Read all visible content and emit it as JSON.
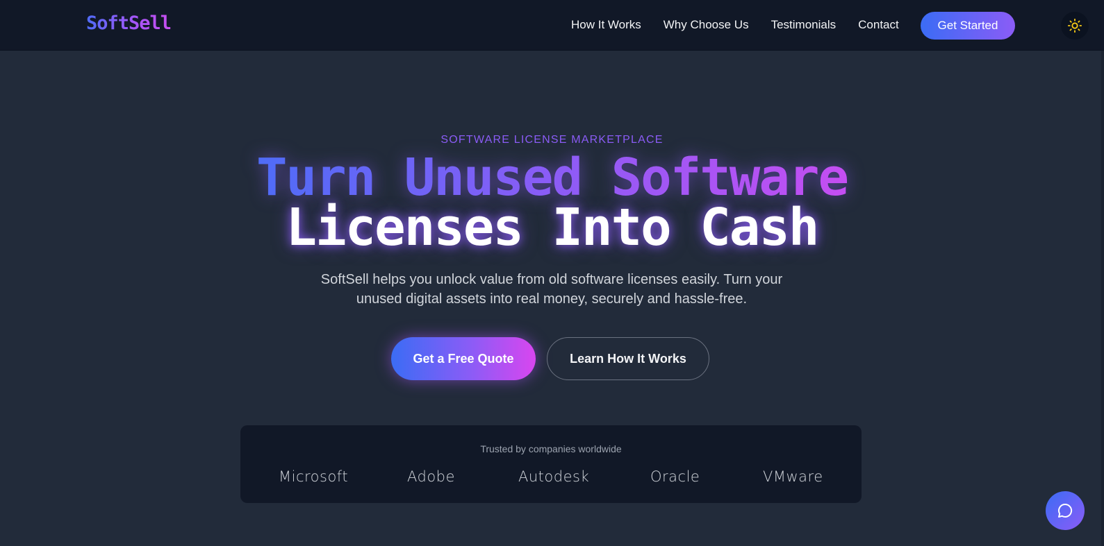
{
  "header": {
    "logo": "SoftSell",
    "nav": [
      "How It Works",
      "Why Choose Us",
      "Testimonials",
      "Contact"
    ],
    "cta": "Get Started",
    "theme_icon": "sun-icon"
  },
  "hero": {
    "eyebrow": "SOFTWARE LICENSE MARKETPLACE",
    "headline_line1": "Turn Unused Software",
    "headline_line2": "Licenses Into Cash",
    "subtitle": "SoftSell helps you unlock value from old software licenses easily. Turn your unused digital assets into real money, securely and hassle-free.",
    "primary_button": "Get a Free Quote",
    "secondary_button": "Learn How It Works"
  },
  "trusted": {
    "label": "Trusted by companies worldwide",
    "companies": [
      "Microsoft",
      "Adobe",
      "Autodesk",
      "Oracle",
      "VMware"
    ]
  },
  "chat": {
    "icon": "chat-bubble-icon"
  },
  "colors": {
    "accent_blue": "#3b6cf5",
    "accent_purple": "#8b5cf6",
    "accent_pink": "#d946ef",
    "background": "#222b3a",
    "header_bg": "#111827"
  }
}
